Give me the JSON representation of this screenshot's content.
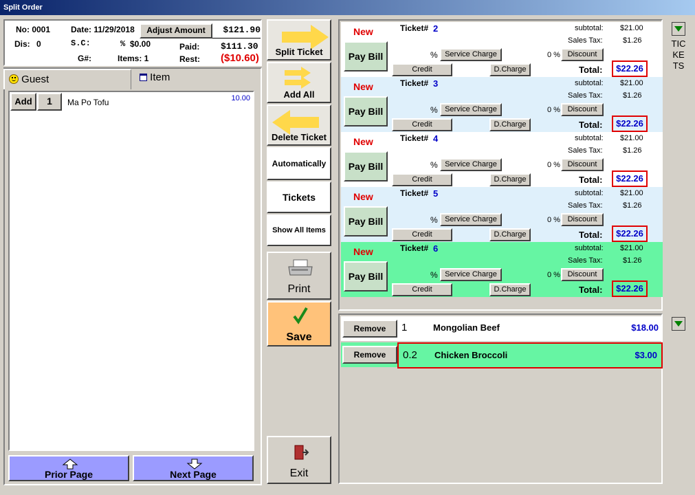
{
  "window": {
    "title": "Split Order"
  },
  "header": {
    "no_label": "No: 0001",
    "date_label": "Date: 11/29/2018",
    "adjust_label": "Adjust Amount",
    "total_amount": "$121.90",
    "dis_label": "Dis:",
    "dis_value": "0",
    "sc_label": "S.C:",
    "sc_pct_label": "%",
    "sc_value": "$0.00",
    "paid_label": "Paid:",
    "paid_value": "$111.30",
    "g_label": "G#:",
    "items_label": "Items: 1",
    "rest_label": "Rest:",
    "rest_value": "($10.60)"
  },
  "tabs": {
    "guest": "Guest",
    "item": "Item"
  },
  "left_list": [
    {
      "add_label": "Add",
      "qty": "1",
      "name": "Ma Po Tofu",
      "price": "10.00"
    }
  ],
  "middle_buttons": {
    "split_ticket": "Split Ticket",
    "add_all": "Add All",
    "delete_ticket": "Delete Ticket",
    "automatically": "Automatically",
    "tickets": "Tickets",
    "show_all_items": "Show All Items",
    "print": "Print",
    "save": "Save",
    "exit": "Exit"
  },
  "nav": {
    "prior_page": "Prior Page",
    "next_page": "Next Page"
  },
  "ticket_labels": {
    "new": "New",
    "ticket": "Ticket#",
    "subtotal": "subtotal:",
    "sales_tax": "Sales Tax:",
    "pay_bill": "Pay Bill",
    "pct": "%",
    "service_charge": "Service Charge",
    "discount_pct": "0 %",
    "discount": "Discount",
    "credit": "Credit",
    "dcharge": "D.Charge",
    "total": "Total:"
  },
  "tickets": [
    {
      "number": "2",
      "subtotal": "$21.00",
      "tax": "$1.26",
      "total": "$22.26",
      "bg": "#ffffff"
    },
    {
      "number": "3",
      "subtotal": "$21.00",
      "tax": "$1.26",
      "total": "$22.26",
      "bg": "#dff0fb"
    },
    {
      "number": "4",
      "subtotal": "$21.00",
      "tax": "$1.26",
      "total": "$22.26",
      "bg": "#ffffff"
    },
    {
      "number": "5",
      "subtotal": "$21.00",
      "tax": "$1.26",
      "total": "$22.26",
      "bg": "#dff0fb"
    },
    {
      "number": "6",
      "subtotal": "$21.00",
      "tax": "$1.26",
      "total": "$22.26",
      "bg": "#66f5a3"
    }
  ],
  "ticket_items": [
    {
      "remove_label": "Remove",
      "qty": "1",
      "name": "Mongolian Beef",
      "price": "$18.00",
      "selected": false
    },
    {
      "remove_label": "Remove",
      "qty": "0.2",
      "name": "Chicken Broccoli",
      "price": "$3.00",
      "selected": true
    }
  ],
  "side": {
    "tickets_vertical": "TICKETS"
  },
  "colors": {
    "accent_red": "#e00000",
    "accent_blue": "#0000c8",
    "selected_green": "#66f5a3",
    "save_orange": "#ffc27a"
  }
}
